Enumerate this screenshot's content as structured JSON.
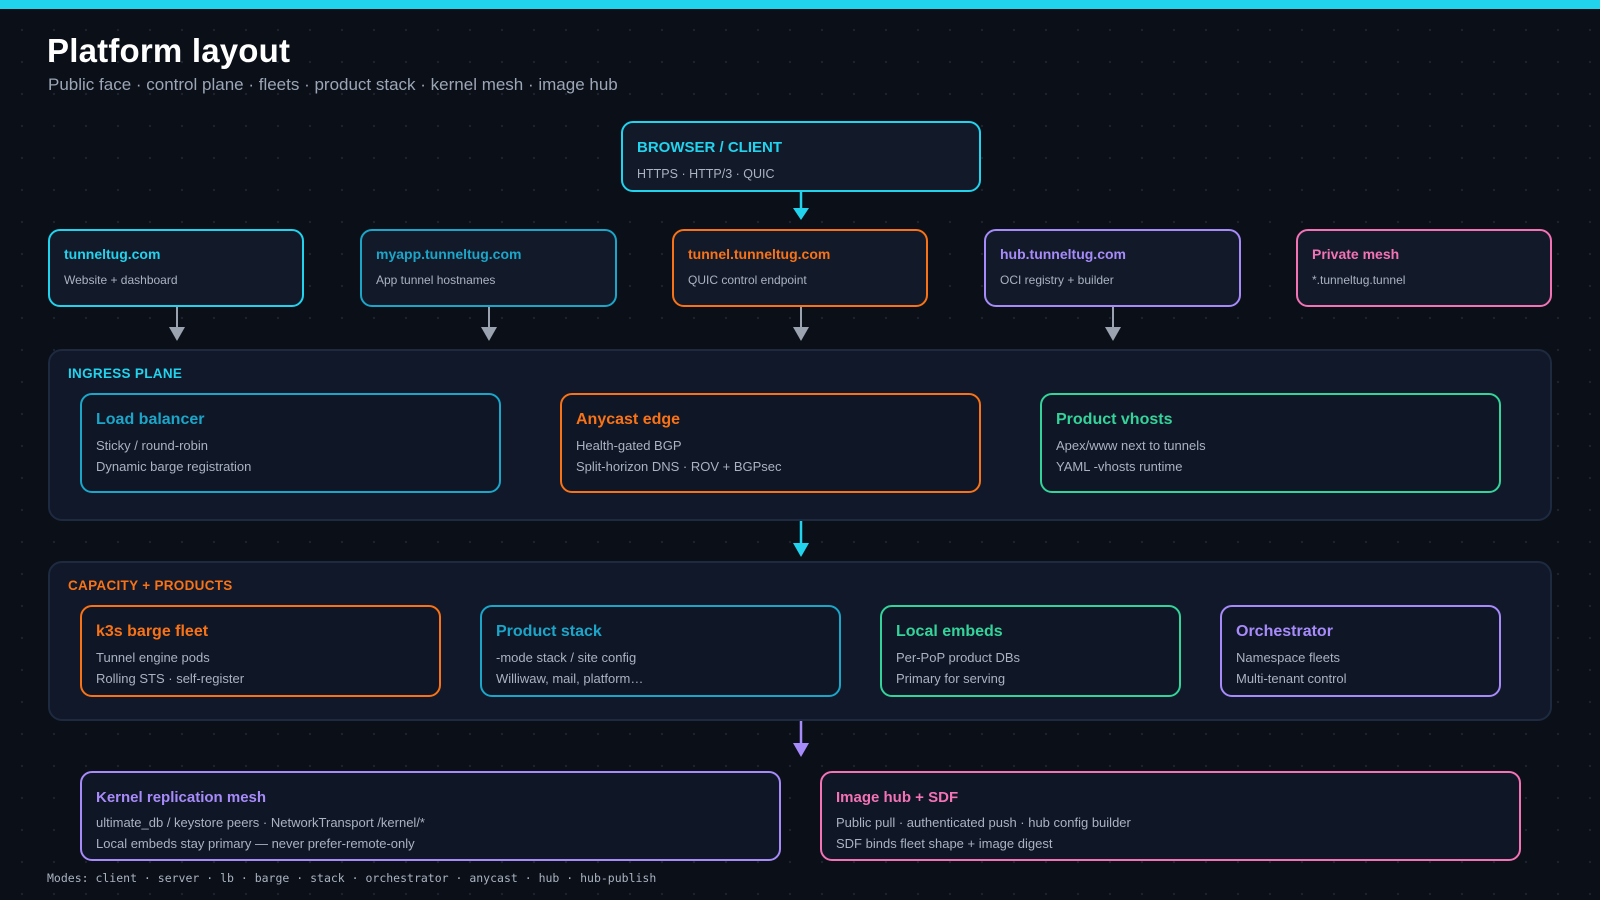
{
  "header": {
    "title": "Platform layout",
    "subtitle": "Public face · control plane · fleets · product stack · kernel mesh · image hub"
  },
  "client": {
    "title": "BROWSER / CLIENT",
    "sub": "HTTPS · HTTP/3 · QUIC",
    "color": "#22d3ee"
  },
  "domains": [
    {
      "title": "tunneltug.com",
      "sub": "Website + dashboard",
      "color": "#22d3ee"
    },
    {
      "title": "myapp.tunneltug.com",
      "sub": "App tunnel hostnames",
      "color": "#1ba6c9"
    },
    {
      "title": "tunnel.tunneltug.com",
      "sub": "QUIC control endpoint",
      "color": "#f97316"
    },
    {
      "title": "hub.tunneltug.com",
      "sub": "OCI registry + builder",
      "color": "#a78bfa"
    },
    {
      "title": "Private mesh",
      "sub": "*.tunneltug.tunnel",
      "color": "#f472b6"
    }
  ],
  "ingress": {
    "label": "INGRESS PLANE",
    "label_color": "#22d3ee",
    "boxes": [
      {
        "title": "Load balancer",
        "line1": "Sticky / round-robin",
        "line2": "Dynamic barge registration",
        "color": "#1ba6c9"
      },
      {
        "title": "Anycast edge",
        "line1": "Health-gated BGP",
        "line2": "Split-horizon DNS · ROV + BGPsec",
        "color": "#f97316"
      },
      {
        "title": "Product vhosts",
        "line1": "Apex/www next to tunnels",
        "line2": "YAML -vhosts runtime",
        "color": "#34d399"
      }
    ]
  },
  "capacity": {
    "label": "CAPACITY + PRODUCTS",
    "label_color": "#f97316",
    "boxes": [
      {
        "title": "k3s barge fleet",
        "line1": "Tunnel engine pods",
        "line2": "Rolling STS · self-register",
        "color": "#f97316"
      },
      {
        "title": "Product stack",
        "line1": "-mode stack / site config",
        "line2": "Williwaw, mail, platform…",
        "color": "#1ba6c9"
      },
      {
        "title": "Local embeds",
        "line1": "Per-PoP product DBs",
        "line2": "Primary for serving",
        "color": "#34d399"
      },
      {
        "title": "Orchestrator",
        "line1": "Namespace fleets",
        "line2": "Multi-tenant control",
        "color": "#a78bfa"
      }
    ]
  },
  "bottom": [
    {
      "title": "Kernel replication mesh",
      "line1": "ultimate_db / keystore peers · NetworkTransport /kernel/*",
      "line2": "Local embeds stay primary — never prefer-remote-only",
      "color": "#a78bfa"
    },
    {
      "title": "Image hub + SDF",
      "line1": "Public pull · authenticated push · hub config builder",
      "line2": "SDF binds fleet shape + image digest",
      "color": "#f472b6"
    }
  ],
  "modes": "Modes: client · server · lb · barge · stack · orchestrator · anycast · hub · hub-publish",
  "arrow_colors": {
    "primary": "#22d3ee",
    "domain": "#9aa3af",
    "mesh": "#a78bfa"
  }
}
